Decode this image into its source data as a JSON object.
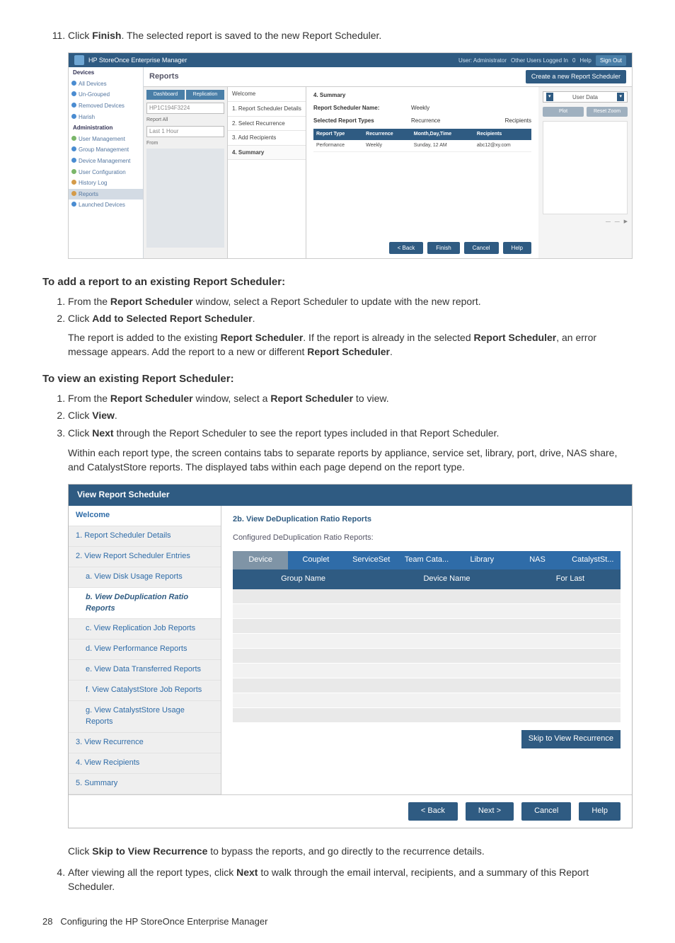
{
  "step11": {
    "num": "11.",
    "pre": "Click ",
    "bold": "Finish",
    "post": ". The selected report is saved to the new Report Scheduler."
  },
  "fig1": {
    "title": "HP StoreOnce Enterprise Manager",
    "top_right": [
      "User: Administrator",
      "Other Users Logged In",
      "0",
      "Help"
    ],
    "top_right_btn": "Sign Out",
    "sidebar": {
      "devices_head": "Devices",
      "devices": [
        "All Devices",
        "Un-Grouped",
        "Removed Devices",
        "Harish"
      ],
      "admin_head": "Administration",
      "admin": [
        "User Management",
        "Group Management",
        "Device Management",
        "User Configuration",
        "History Log",
        "Reports",
        "Launched Devices"
      ]
    },
    "reports_label": "Reports",
    "create_btn": "Create a new Report Scheduler",
    "filters": {
      "tab1": "Dashboard",
      "tab2": "Replication",
      "inp1": "HP1C194F3224",
      "lbl1": "Report All",
      "inp2": "Last 1 Hour",
      "lbl2": "From"
    },
    "steps": [
      "Welcome",
      "1. Report Scheduler Details",
      "2. Select Recurrence",
      "3. Add Recipients",
      "4. Summary"
    ],
    "summary": {
      "title": "4. Summary",
      "name_k": "Report Scheduler Name:",
      "name_v": "Weekly",
      "types_k": "Selected Report Types",
      "recur_k": "Recurrence",
      "recip_k": "Recipients",
      "cols": [
        "Report Type",
        "Recurrence",
        "Month,Day,Time",
        "Recipients"
      ],
      "row": [
        "Performance",
        "Weekly",
        "Sunday, 12 AM",
        "abc12@xy.com"
      ]
    },
    "right": {
      "sel": "User Data",
      "btn1": "Plot",
      "btn2": "Reset Zoom"
    },
    "bottom": [
      "< Back",
      "Finish",
      "Cancel",
      "Help"
    ]
  },
  "sec1": {
    "heading": "To add a report to an existing Report Scheduler:",
    "li1_pre": "From the ",
    "li1_b": "Report Scheduler",
    "li1_post": " window, select a Report Scheduler to update with the new report.",
    "li2_pre": "Click ",
    "li2_b": "Add to Selected Report Scheduler",
    "li2_post": ".",
    "para_a": "The report is added to the existing ",
    "para_b": "Report Scheduler",
    "para_c": ". If the report is already in the selected ",
    "para_d": "Report Scheduler",
    "para_e": ", an error message appears. Add the report to a new or different ",
    "para_f": "Report Scheduler",
    "para_g": "."
  },
  "sec2": {
    "heading": "To view an existing Report Scheduler:",
    "li1_pre": "From the ",
    "li1_b1": "Report Scheduler",
    "li1_mid": " window, select a ",
    "li1_b2": "Report Scheduler",
    "li1_post": " to view.",
    "li2_pre": "Click ",
    "li2_b": "View",
    "li2_post": ".",
    "li3_pre": "Click ",
    "li3_b": "Next",
    "li3_post": " through the Report Scheduler to see the report types included in that Report Scheduler.",
    "li3_para": "Within each report type, the screen contains tabs to separate reports by appliance, service set, library, port, drive, NAS share, and CatalystStore reports. The displayed tabs within each page depend on the report type."
  },
  "fig2": {
    "title": "View Report Scheduler",
    "nav": [
      "Welcome",
      "1. Report Scheduler Details",
      "2. View Report Scheduler Entries",
      "a. View Disk Usage Reports",
      "b. View DeDuplication Ratio Reports",
      "c. View Replication Job Reports",
      "d. View Performance Reports",
      "e. View Data Transferred Reports",
      "f. View CatalystStore Job Reports",
      "g. View CatalystStore Usage Reports",
      "3. View Recurrence",
      "4. View Recipients",
      "5. Summary"
    ],
    "content_h": "2b. View DeDuplication Ratio Reports",
    "content_sub": "Configured DeDuplication Ratio Reports:",
    "tabs": [
      "Device",
      "Couplet",
      "ServiceSet",
      "Team Cata...",
      "Library",
      "NAS",
      "CatalystSt..."
    ],
    "cols": [
      "Group Name",
      "Device Name",
      "For Last"
    ],
    "skip": "Skip to View Recurrence",
    "bottom": [
      "< Back",
      "Next >",
      "Cancel",
      "Help"
    ]
  },
  "after_fig2": {
    "p1_pre": "Click ",
    "p1_b": "Skip to View Recurrence",
    "p1_post": " to bypass the reports, and go directly to the recurrence details.",
    "li4_pre": "After viewing all the report types, click ",
    "li4_b": "Next",
    "li4_post": " to walk through the email interval, recipients, and a summary of this Report Scheduler."
  },
  "footer": {
    "page": "28",
    "text": "Configuring the HP StoreOnce Enterprise Manager"
  }
}
